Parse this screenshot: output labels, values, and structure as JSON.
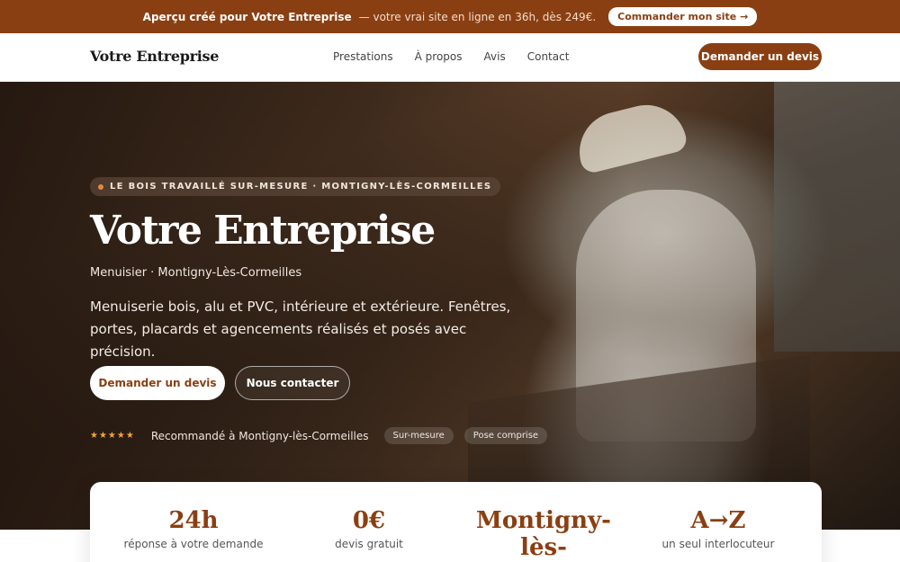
{
  "promo": {
    "lead": "Aperçu créé pour Votre Entreprise",
    "text": "— votre vrai site en ligne en 36h, dès 249€.",
    "button": "Commander mon site →"
  },
  "nav": {
    "brand": "Votre Entreprise",
    "links": [
      "Prestations",
      "À propos",
      "Avis",
      "Contact"
    ],
    "cta": "Demander un devis"
  },
  "hero": {
    "tag": "LE BOIS TRAVAILLÉ SUR-MESURE · MONTIGNY-LÈS-CORMEILLES",
    "title": "Votre Entreprise",
    "subtitle": "Menuisier · Montigny-Lès-Cormeilles",
    "description": "Menuiserie bois, alu et PVC, intérieure et extérieure. Fenêtres, portes, placards et agencements réalisés et posés avec précision.",
    "primary_button": "Demander un devis",
    "secondary_button": "Nous contacter",
    "stars": "★★★★★",
    "recommendation": "Recommandé à Montigny-lès-Cormeilles",
    "chips": [
      "Sur-mesure",
      "Pose comprise"
    ]
  },
  "stats": [
    {
      "value": "24h",
      "label": "réponse à votre demande"
    },
    {
      "value": "0€",
      "label": "devis gratuit"
    },
    {
      "value": "Montigny-lès-",
      "label": ""
    },
    {
      "value": "A→Z",
      "label": "un seul interlocuteur"
    }
  ],
  "colors": {
    "brand": "#8a3f12",
    "star": "#f0a53a",
    "tag_dot": "#e08a3a"
  }
}
